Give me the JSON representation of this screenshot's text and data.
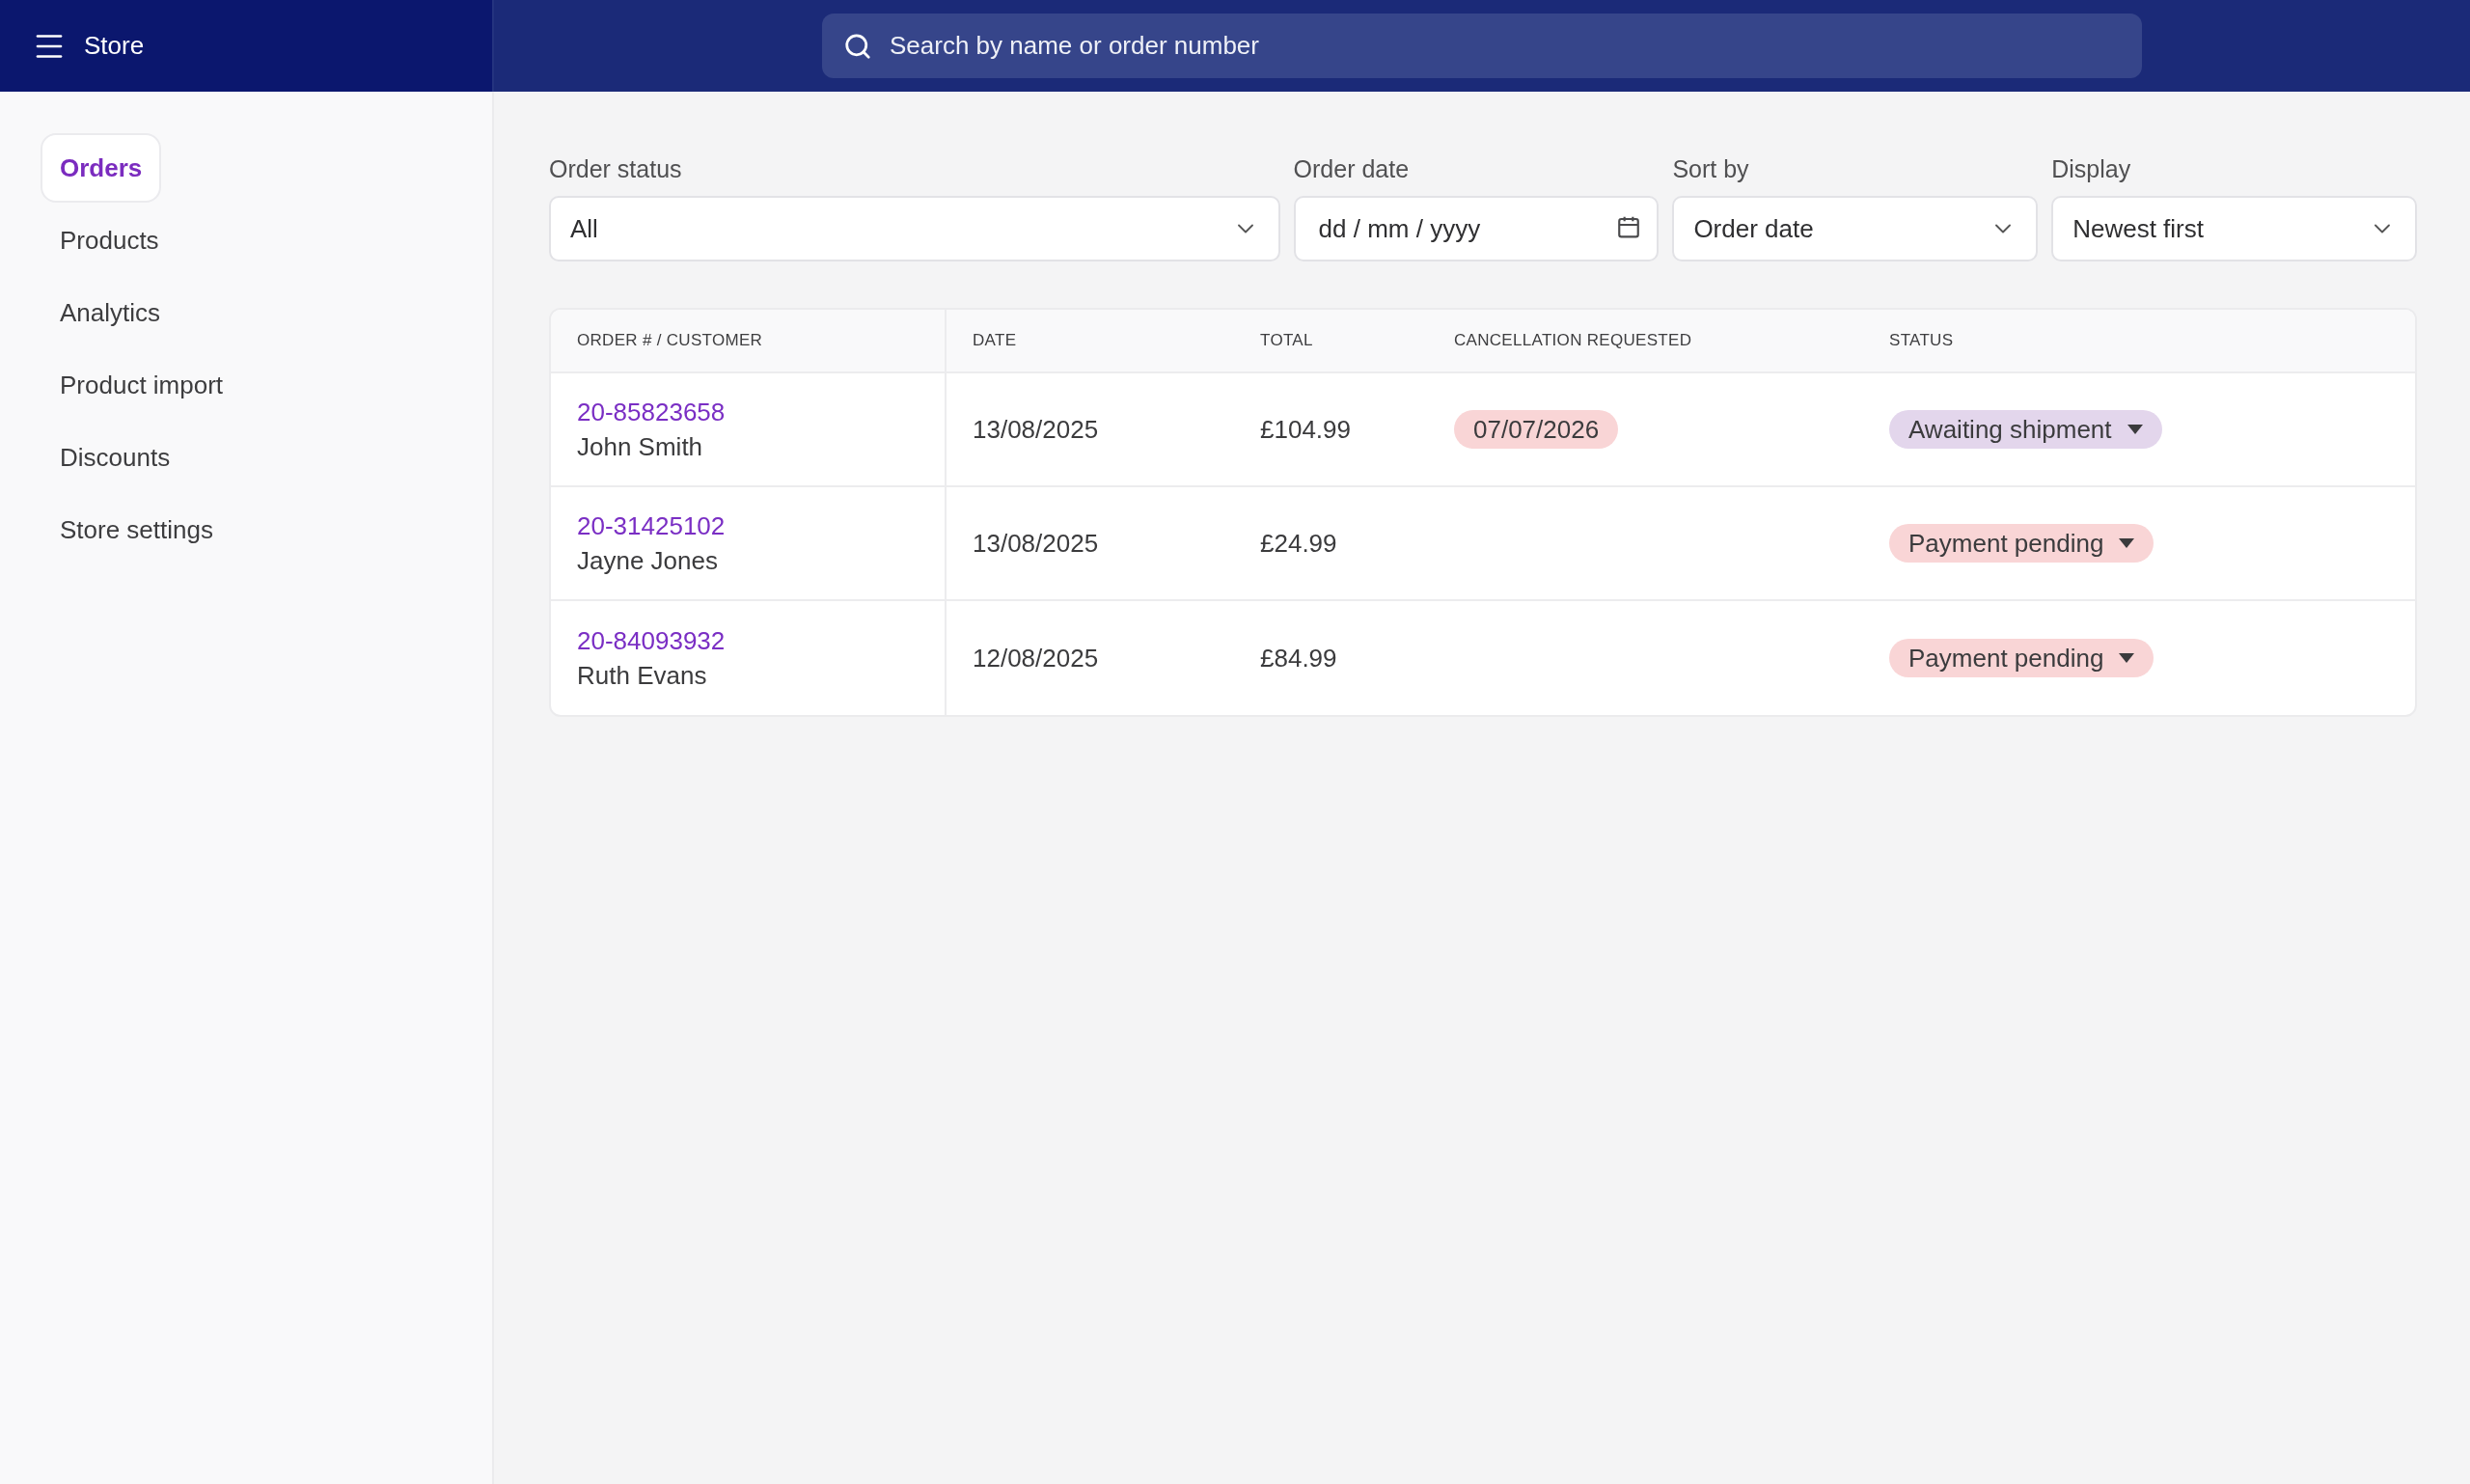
{
  "app_bar": {
    "title": "Store",
    "search": {
      "placeholder": "Search by name or order number"
    }
  },
  "sidebar": {
    "items": [
      {
        "label": "Orders",
        "selected": true
      },
      {
        "label": "Products",
        "selected": false
      },
      {
        "label": "Analytics",
        "selected": false
      },
      {
        "label": "Product import",
        "selected": false
      },
      {
        "label": "Discounts",
        "selected": false
      },
      {
        "label": "Store settings",
        "selected": false
      }
    ]
  },
  "filters": [
    {
      "label": "Order status",
      "kind": "select",
      "value": "All"
    },
    {
      "label": "Order date",
      "kind": "date",
      "placeholder": "dd / mm / yyyy"
    },
    {
      "label": "Sort by",
      "kind": "select",
      "value": "Order date"
    },
    {
      "label": "Display",
      "kind": "select",
      "value": "Newest first"
    }
  ],
  "table": {
    "columns": [
      "ORDER # / CUSTOMER",
      "DATE",
      "TOTAL",
      "CANCELLATION REQUESTED",
      "STATUS"
    ],
    "rows": [
      {
        "order_number": "20-85823658",
        "customer": "John Smith",
        "date": "13/08/2025",
        "total": "£104.99",
        "cancellation_requested": "07/07/2026",
        "status": {
          "label": "Awaiting shipment",
          "color": "#e3d6ec"
        }
      },
      {
        "order_number": "20-31425102",
        "customer": "Jayne Jones",
        "date": "13/08/2025",
        "total": "£24.99",
        "status": {
          "label": "Payment pending",
          "color": "#f9d5d6"
        }
      },
      {
        "order_number": "20-84093932",
        "customer": "Ruth Evans",
        "date": "12/08/2025",
        "total": "£84.99",
        "status": {
          "label": "Payment pending",
          "color": "#f9d5d6"
        }
      }
    ]
  }
}
